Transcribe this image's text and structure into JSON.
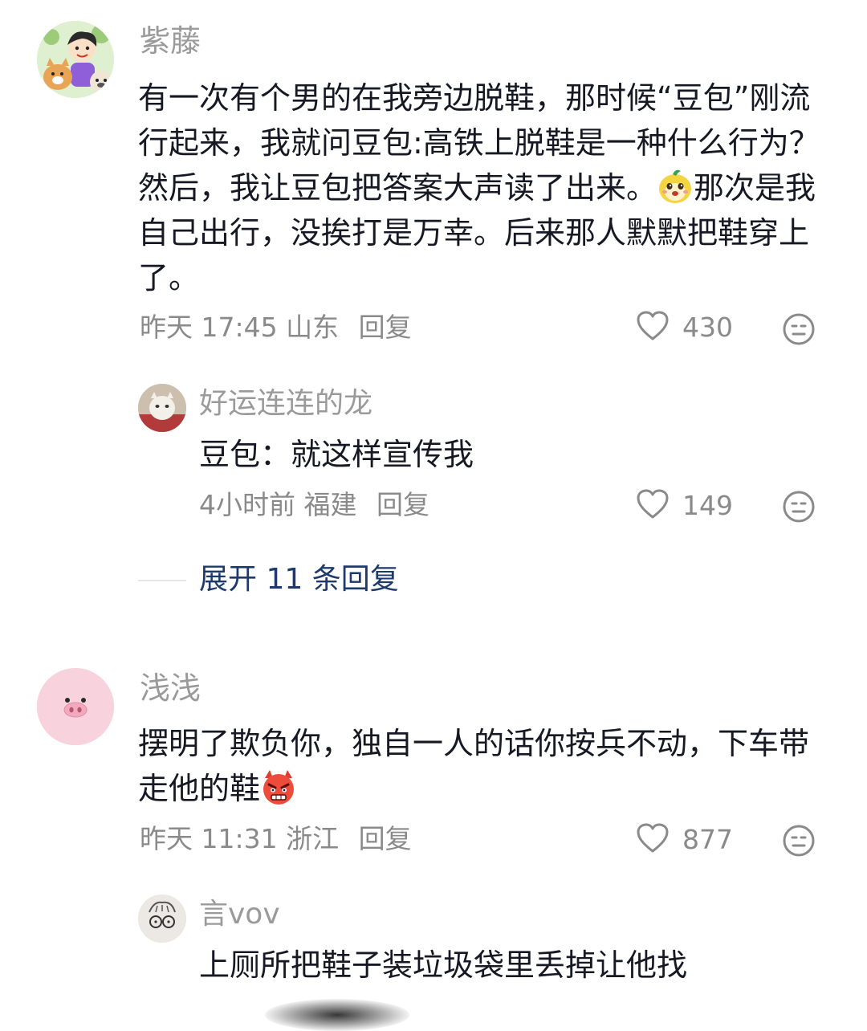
{
  "comments": [
    {
      "user": "紫藤",
      "text_before_emoji": "有一次有个男的在我旁边脱鞋，那时候“豆包”刚流行起来，我就问豆包:高铁上脱鞋是一种什么行为？然后，我让豆包把答案大声读了出来。",
      "text_after_emoji": "那次是我自己出行，没挨打是万幸。后来那人默默把鞋穿上了。",
      "time": "昨天 17:45",
      "location": "山东",
      "reply_label": "回复",
      "likes": "430",
      "replies": [
        {
          "user": "好运连连的龙",
          "text": "豆包：就这样宣传我",
          "time": "4小时前",
          "location": "福建",
          "reply_label": "回复",
          "likes": "149"
        }
      ],
      "expand_label": "展开 11 条回复"
    },
    {
      "user": "浅浅",
      "text": "摆明了欺负你，独自一人的话你按兵不动，下车带走他的鞋",
      "time": "昨天 11:31",
      "location": "浙江",
      "reply_label": "回复",
      "likes": "877",
      "replies": [
        {
          "user": "言vov",
          "text": "上厕所把鞋子装垃圾袋里丢掉让他找"
        }
      ]
    }
  ],
  "icons": {
    "like": "heart-outline-icon",
    "dislike": "neutral-face-icon",
    "emoji_1": "doubao-mascot-emoji",
    "emoji_2": "angry-devil-emoji"
  }
}
